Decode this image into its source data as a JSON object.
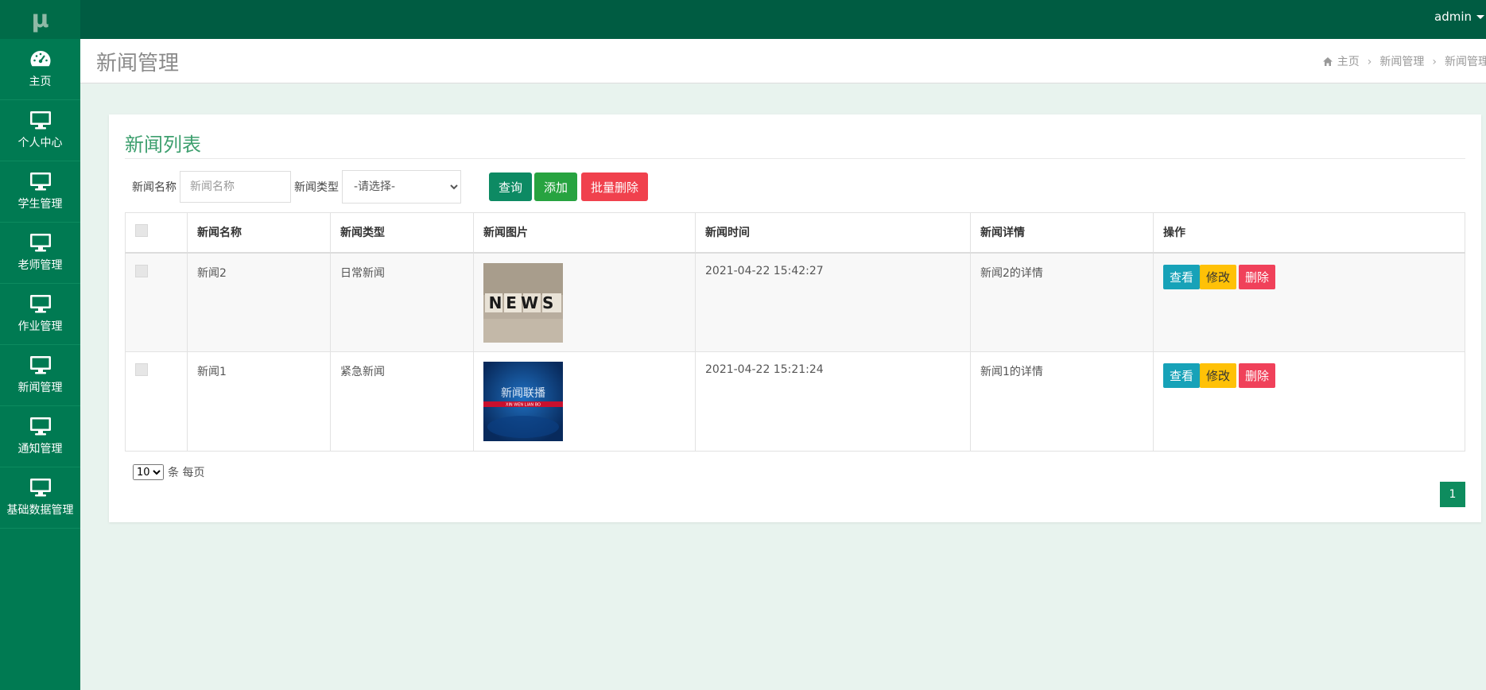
{
  "app": {
    "logo_text": "μ",
    "user": "admin"
  },
  "sidebar": {
    "items": [
      {
        "label": "主页",
        "icon": "dashboard-icon"
      },
      {
        "label": "个人中心",
        "icon": "monitor-icon"
      },
      {
        "label": "学生管理",
        "icon": "monitor-icon"
      },
      {
        "label": "老师管理",
        "icon": "monitor-icon"
      },
      {
        "label": "作业管理",
        "icon": "monitor-icon"
      },
      {
        "label": "新闻管理",
        "icon": "monitor-icon"
      },
      {
        "label": "通知管理",
        "icon": "monitor-icon"
      },
      {
        "label": "基础数据管理",
        "icon": "monitor-icon"
      }
    ]
  },
  "header": {
    "title": "新闻管理",
    "breadcrumb": [
      "主页",
      "新闻管理",
      "新闻管理"
    ]
  },
  "panel": {
    "title": "新闻列表",
    "search": {
      "name_label": "新闻名称",
      "name_placeholder": "新闻名称",
      "type_label": "新闻类型",
      "type_selected": "-请选择-"
    },
    "buttons": {
      "query": "查询",
      "add": "添加",
      "batch_delete": "批量删除"
    }
  },
  "table": {
    "columns": [
      "新闻名称",
      "新闻类型",
      "新闻图片",
      "新闻时间",
      "新闻详情",
      "操作"
    ],
    "rows": [
      {
        "name": "新闻2",
        "type": "日常新闻",
        "image": "news-blocks-image",
        "time": "2021-04-22 15:42:27",
        "detail": "新闻2的详情"
      },
      {
        "name": "新闻1",
        "type": "紧急新闻",
        "image": "xinwen-lianbo-image",
        "time": "2021-04-22 15:21:24",
        "detail": "新闻1的详情"
      }
    ],
    "actions": {
      "view": "查看",
      "edit": "修改",
      "delete": "删除"
    },
    "thumb_text": {
      "news": "NEWS",
      "xwlb_cn": "新闻联播",
      "xwlb_en": "XIN WEN LIAN BO"
    }
  },
  "pagination": {
    "page_size": "10",
    "page_size_suffix": "条 每页",
    "current_page": "1"
  },
  "colors": {
    "topbar": "#005c42",
    "sidebar": "#007a52",
    "accent": "#3d9f6e"
  }
}
